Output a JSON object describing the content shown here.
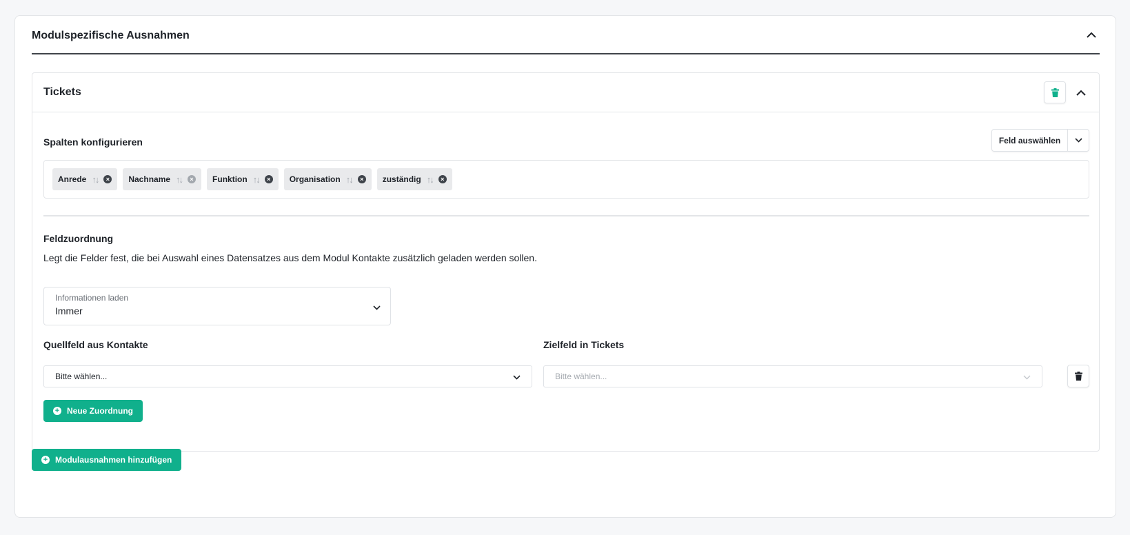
{
  "section": {
    "title": "Modulspezifische Ausnahmen"
  },
  "card": {
    "title": "Tickets",
    "columns": {
      "label": "Spalten konfigurieren",
      "select_button": "Feld auswählen",
      "chips": [
        {
          "label": "Anrede",
          "sort_icon": "↑↓",
          "remove_icon": "×"
        },
        {
          "label": "Nachname",
          "sort_icon": "↑↓",
          "remove_icon": "×"
        },
        {
          "label": "Funktion",
          "sort_icon": "↑↓",
          "remove_icon": "×"
        },
        {
          "label": "Organisation",
          "sort_icon": "↑↓",
          "remove_icon": "×"
        },
        {
          "label": "zuständig",
          "sort_icon": "↑↓",
          "remove_icon": "×"
        }
      ]
    },
    "mapping": {
      "heading": "Feldzuordnung",
      "description": "Legt die Felder fest, die bei Auswahl eines Datensatzes aus dem Modul Kontakte zusätzlich geladen werden sollen.",
      "load_info": {
        "label": "Informationen laden",
        "value": "Immer"
      },
      "source_label": "Quellfeld aus Kontakte",
      "target_label": "Zielfeld in Tickets",
      "source_placeholder": "Bitte wählen...",
      "target_placeholder": "Bitte wählen...",
      "new_button": "Neue Zuordnung",
      "plus_icon": "+"
    }
  },
  "add_button": "Modulausnahmen hinzufügen",
  "add_plus_icon": "+",
  "colors": {
    "accent": "#10b08c",
    "chip_bg": "#e9eaec",
    "border": "#e3e5e8"
  }
}
